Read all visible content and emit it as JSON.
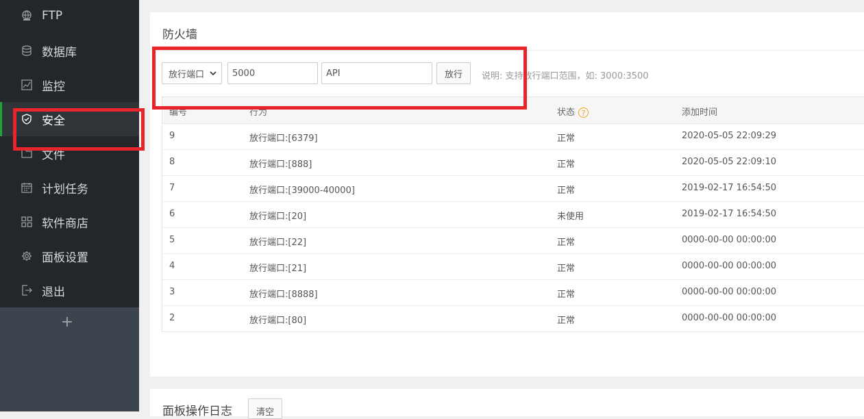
{
  "sidebar": {
    "items": [
      {
        "label": "FTP",
        "icon": "ftp-icon"
      },
      {
        "label": "数据库",
        "icon": "database-icon"
      },
      {
        "label": "监控",
        "icon": "monitor-icon"
      },
      {
        "label": "安全",
        "icon": "shield-icon",
        "active": true
      },
      {
        "label": "文件",
        "icon": "folder-icon"
      },
      {
        "label": "计划任务",
        "icon": "calendar-icon"
      },
      {
        "label": "软件商店",
        "icon": "apps-icon"
      },
      {
        "label": "面板设置",
        "icon": "gear-icon"
      },
      {
        "label": "退出",
        "icon": "logout-icon"
      }
    ],
    "add_label": "+"
  },
  "firewall": {
    "title": "防火墙",
    "select_value": "放行端口",
    "port_value": "5000",
    "remark_value": "API",
    "submit_label": "放行",
    "note": "说明: 支持放行端口范围，如: 3000:3500"
  },
  "table": {
    "headers": [
      "编号",
      "行为",
      "状态",
      "添加时间"
    ],
    "rows": [
      [
        "9",
        "放行端口:[6379]",
        "正常",
        "2020-05-05 22:09:29"
      ],
      [
        "8",
        "放行端口:[888]",
        "正常",
        "2020-05-05 22:09:10"
      ],
      [
        "7",
        "放行端口:[39000-40000]",
        "正常",
        "2019-02-17 16:54:50"
      ],
      [
        "6",
        "放行端口:[20]",
        "未使用",
        "2019-02-17 16:54:50"
      ],
      [
        "5",
        "放行端口:[22]",
        "正常",
        "0000-00-00 00:00:00"
      ],
      [
        "4",
        "放行端口:[21]",
        "正常",
        "0000-00-00 00:00:00"
      ],
      [
        "3",
        "放行端口:[8888]",
        "正常",
        "0000-00-00 00:00:00"
      ],
      [
        "2",
        "放行端口:[80]",
        "正常",
        "0000-00-00 00:00:00"
      ]
    ]
  },
  "log_panel": {
    "title": "面板操作日志",
    "clear_label": "清空"
  },
  "colors": {
    "accent": "#20a53a",
    "highlight": "#e8252a",
    "sidebar_bg": "#23272b"
  }
}
